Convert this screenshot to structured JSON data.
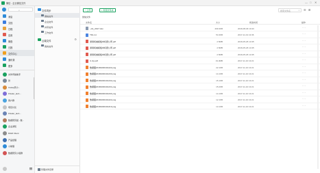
{
  "app": {
    "title": "微信 - 企业微信文件",
    "minimize": "—",
    "maximize": "□",
    "close": "✕"
  },
  "sidebar": {
    "search_icon": "⌕",
    "nav": [
      {
        "label": "消息",
        "color": "#2e8bd8",
        "icon": "chat-icon"
      },
      {
        "label": "文档",
        "color": "#3b7de0",
        "icon": "document-icon"
      },
      {
        "label": "日程",
        "color": "#e8a33d",
        "icon": "calendar-icon"
      },
      {
        "label": "应用",
        "color": "#e05a4f",
        "icon": "app-icon"
      },
      {
        "label": "微盘",
        "color": "#2e8bd8",
        "icon": "drive-icon"
      },
      {
        "label": "日报",
        "color": "#19a15f",
        "icon": "report-icon"
      },
      {
        "label": "文件中心",
        "color": "#f0a020",
        "icon": "folder-icon"
      },
      {
        "label": "通讯录",
        "color": "#2e8bd8",
        "icon": "contacts-icon"
      },
      {
        "label": "更多",
        "color": "#19a15f",
        "icon": "more-apps-icon"
      }
    ],
    "contacts": [
      {
        "name": "文件传输助手",
        "color": "#19a15f"
      },
      {
        "name": "张",
        "color": "#7a8899"
      },
      {
        "name": "Caisa(周小...",
        "color": "#d78b3c"
      },
      {
        "name": "Fbsder_lan1...",
        "color": "#7f6ed8"
      },
      {
        "name": "客户群",
        "color": "#4aa3df"
      },
      {
        "name": "项目讨论",
        "color": "#c4c4c4"
      },
      {
        "name": "Fbsder_lan1...",
        "color": "#6b84b5"
      },
      {
        "name": "数据研究组 - 数...",
        "color": "#b17a5c"
      },
      {
        "name": "企业通知",
        "color": "#19a15f"
      },
      {
        "name": "Ri&D Client",
        "color": "#8c8c8c"
      },
      {
        "name": "产品经理",
        "color": "#3e6fb0"
      },
      {
        "name": "小助理",
        "color": "#2e8bd8"
      },
      {
        "name": "数据研究小组群",
        "color": "#d35454"
      }
    ],
    "bottom_icon": "menu-icon"
  },
  "tree": {
    "group1": {
      "label": "文件同步",
      "color": "#2e8bd8"
    },
    "group1_items": [
      {
        "label": "微信文件",
        "color": "#6b7b8c"
      },
      {
        "label": "企业文件",
        "color": "#6b7b8c"
      },
      {
        "label": "共享文件",
        "color": "#6b7b8c"
      },
      {
        "label": "工作文件",
        "color": "#6b7b8c"
      }
    ],
    "group2": {
      "label": "云端文件",
      "color": "#19a15f"
    },
    "group2_items": [
      {
        "label": "我的文件",
        "color": "#6b7b8c"
      }
    ],
    "settings_icon": "⚙",
    "bottom_label": "管理文件目录"
  },
  "toolbar": {
    "upload_label": "↑ 上传",
    "new_folder_label": "+ 新建文件夹",
    "search_placeholder": "搜索文件名",
    "search_icon": "⌕",
    "list_view_icon": "☰",
    "grid_view_icon": "⊞"
  },
  "breadcrumb": "微信文件",
  "table": {
    "headers": {
      "name": "文件名",
      "size": "大小",
      "date": "修改时间",
      "action": "操作"
    },
    "more_glyph": "···",
    "rows": [
      {
        "name": "~cls_2017.xlsx",
        "size": "209.3KB",
        "date": "2016-08-29 10:43",
        "color": "#8c9bb0"
      },
      {
        "name": "TDL.txt",
        "size": "54.3KB",
        "date": "2017-11-01 13:36",
        "color": "#4b84e0"
      },
      {
        "name": "通用机械模板中标题公司.pdf",
        "size": "2.5MB",
        "date": "2016-05-26 13:45",
        "color": "#e05a4f"
      },
      {
        "name": "通用机械模板中标题公司.pdf",
        "size": "2.5MB",
        "date": "2016-05-26 13:45",
        "color": "#e05a4f"
      },
      {
        "name": "通用机械模板中标题公司.pdf",
        "size": "2.5MB",
        "date": "2016-05-26 13:45",
        "color": "#e05a4f"
      },
      {
        "name": "C.zip.pdf",
        "size": "19.3MB",
        "date": "2017-11-10 13:21",
        "color": "#e05a4f"
      },
      {
        "name": "数据图20181000101222.png",
        "size": "22.1KB",
        "date": "2017-11-10 13:21",
        "color": "#f0802e"
      },
      {
        "name": "数据图20181000101233.png",
        "size": "14.1KB",
        "date": "2017-11-10 13:21",
        "color": "#f0802e"
      },
      {
        "name": "数据图20181000101232.png",
        "size": "15.1KB",
        "date": "2017-11-10 13:21",
        "color": "#f0802e"
      },
      {
        "name": "数据图20181000101231.png",
        "size": "15.2KB",
        "date": "2017-11-10 13:21",
        "color": "#f0802e"
      },
      {
        "name": "数据图20181000101234.png",
        "size": "14.1KB",
        "date": "2017-11-10 13:21",
        "color": "#f0802e"
      },
      {
        "name": "数据图20181000101222.png",
        "size": "12.1KB",
        "date": "2017-11-10 13:21",
        "color": "#f0802e"
      },
      {
        "name": "数据图20181000101219.png",
        "size": "13.1KB",
        "date": "2017-11-10 13:21",
        "color": "#f0802e"
      }
    ]
  }
}
